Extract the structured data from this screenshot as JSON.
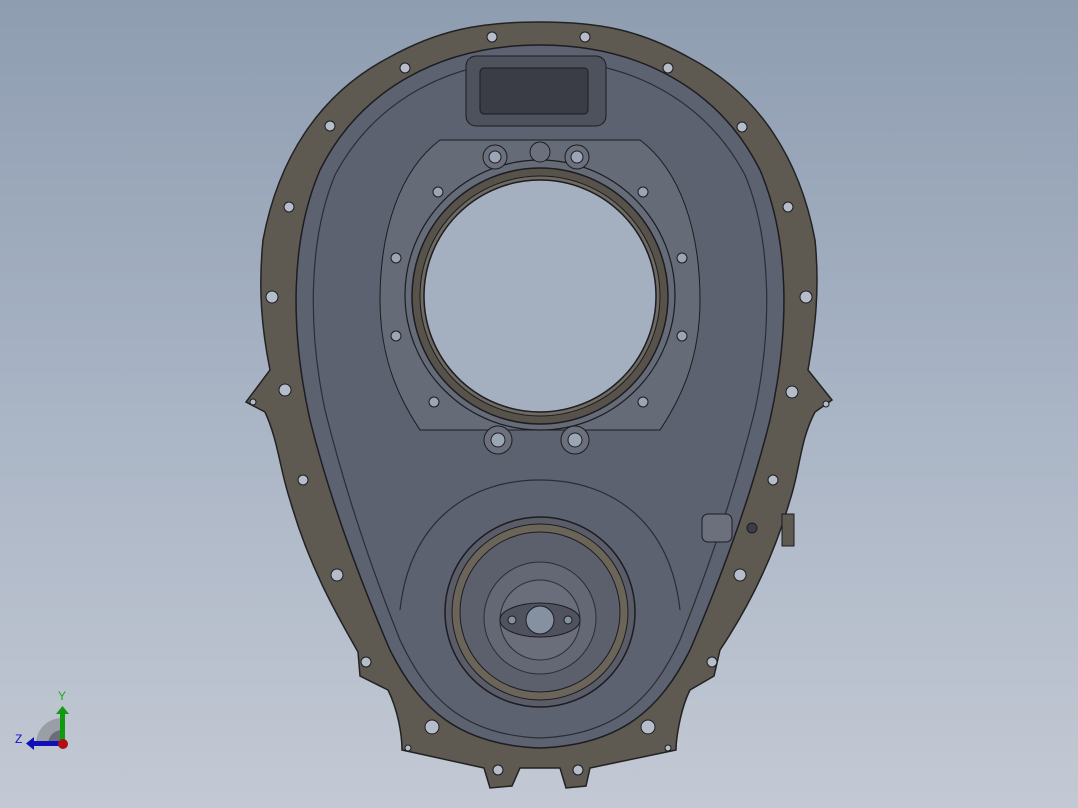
{
  "viewport": {
    "model": "timing-cover",
    "colors": {
      "background_top": "#8f9db1",
      "background_bottom": "#c3c9d4",
      "gasket": "#5e5a52",
      "body": "#5d6270",
      "axis_x": "#cc1010",
      "axis_y": "#0f9a0f",
      "axis_z": "#1010b8"
    }
  },
  "triad": {
    "y_label": "Y",
    "z_label": "Z"
  }
}
